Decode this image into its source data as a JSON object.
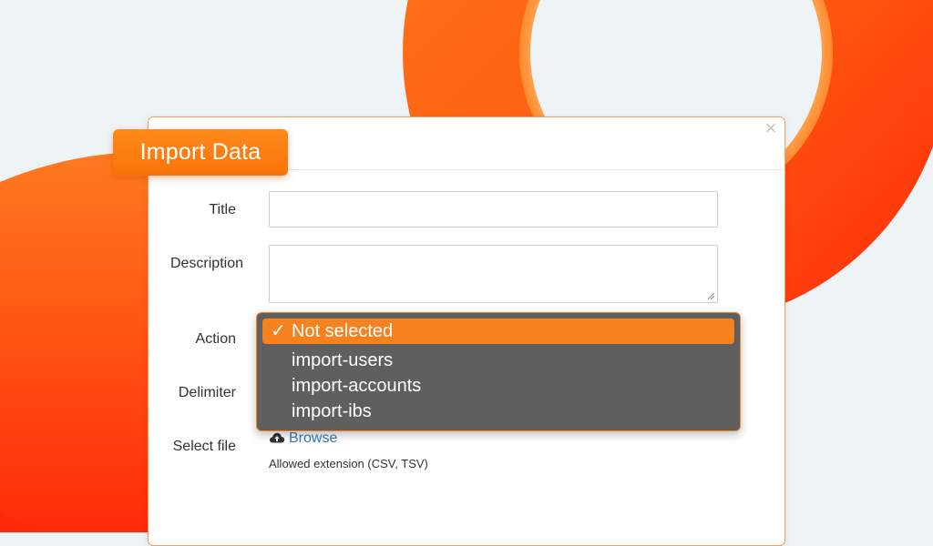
{
  "dialog": {
    "title": "Import Data",
    "close_label": "×"
  },
  "form": {
    "title_label": "Title",
    "title_value": "",
    "description_label": "Description",
    "description_value": "",
    "action_label": "Action",
    "delimiter_label": "Delimiter",
    "select_file_label": "Select file",
    "browse_label": "Browse",
    "allowed_extension": "Allowed extension (CSV, TSV)"
  },
  "action_dropdown": {
    "options": [
      {
        "label": "Not selected",
        "selected": true
      },
      {
        "label": "import-users",
        "selected": false
      },
      {
        "label": "import-accounts",
        "selected": false
      },
      {
        "label": "import-ibs",
        "selected": false
      }
    ],
    "check_glyph": "✓"
  },
  "colors": {
    "accent": "#f5821f",
    "dropdown_bg": "#5f5f5f",
    "link": "#3a7bc0",
    "background": "#eef3f5"
  },
  "icons": {
    "browse": "cloud-upload-icon",
    "close": "close-icon",
    "check": "check-icon"
  }
}
